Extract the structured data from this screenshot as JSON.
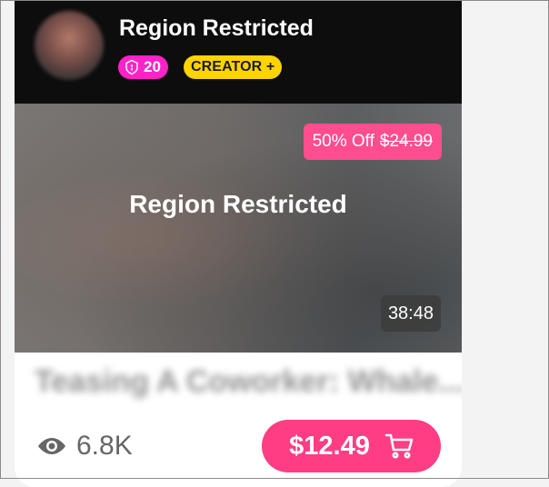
{
  "card": {
    "creator_name": "Region Restricted",
    "video_count": "20",
    "tier_badge": "CREATOR +",
    "discount_label": "50% Off",
    "original_price": "$24.99",
    "overlay_title": "Region Restricted",
    "duration": "38:48",
    "video_title": "Teasing A Coworker: Whale...",
    "views": "6.8K",
    "price": "$12.49"
  },
  "colors": {
    "header_bg": "#0d0d0d",
    "count_badge": "#ff22c9",
    "tier_badge": "#ffd400",
    "accent_pink": "#ff3d84"
  },
  "icons": {
    "count_badge": "video-lock-icon",
    "views": "eye-icon",
    "price": "cart-icon"
  }
}
